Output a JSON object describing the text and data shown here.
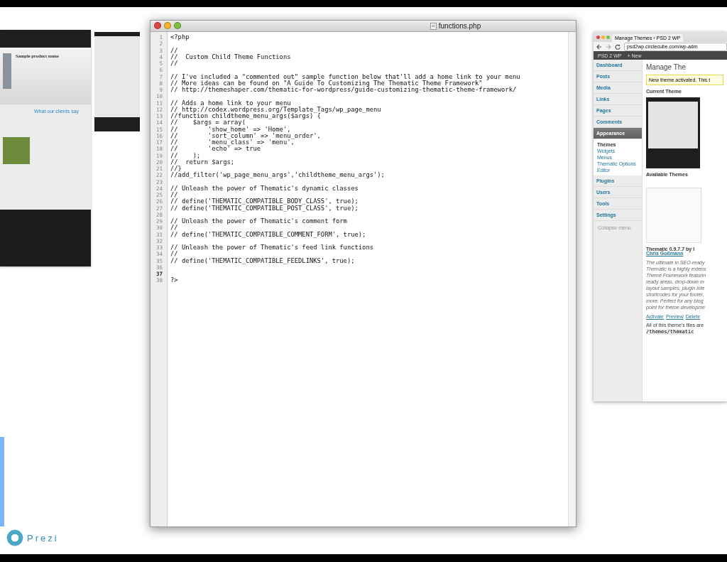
{
  "left_screens": {
    "product_title": "Sample product name",
    "testimonials_heading": "What our clients say"
  },
  "editor": {
    "title": "functions.php",
    "lines": [
      {
        "number": "1",
        "text": "<?php"
      },
      {
        "number": "2"
      },
      {
        "number": "3",
        "text": "//"
      },
      {
        "number": "4",
        "text": "//  Custom Child Theme Functions"
      },
      {
        "number": "5",
        "text": "//"
      },
      {
        "number": "6"
      },
      {
        "number": "7",
        "text": "// I've included a \"commented out\" sample function below that'll add a home link to your menu"
      },
      {
        "number": "8",
        "text": "// More ideas can be found on \"A Guide To Customizing The Thematic Theme Framework\""
      },
      {
        "number": "9",
        "text": "// http://themeshaper.com/thematic-for-wordpress/guide-customizing-thematic-theme-framework/"
      },
      {
        "number": "10"
      },
      {
        "number": "11",
        "text": "// Adds a home link to your menu"
      },
      {
        "number": "12",
        "text": "// http://codex.wordpress.org/Template_Tags/wp_page_menu"
      },
      {
        "number": "13",
        "text": "//function childtheme_menu_args($args) {"
      },
      {
        "number": "14",
        "text": "//    $args = array("
      },
      {
        "number": "15",
        "text": "//        'show_home' => 'Home',"
      },
      {
        "number": "16",
        "text": "//        'sort_column' => 'menu_order',"
      },
      {
        "number": "17",
        "text": "//        'menu_class' => 'menu',"
      },
      {
        "number": "18",
        "text": "//        'echo' => true"
      },
      {
        "number": "19",
        "text": "//    );"
      },
      {
        "number": "20",
        "text": "//  return $args;"
      },
      {
        "number": "21",
        "text": "//}"
      },
      {
        "number": "22",
        "text": "//add_filter('wp_page_menu_args','childtheme_menu_args');"
      },
      {
        "number": "23"
      },
      {
        "number": "24",
        "text": "// Unleash the power of Thematic's dynamic classes"
      },
      {
        "number": "25",
        "text": "//"
      },
      {
        "number": "26",
        "text": "// define('THEMATIC_COMPATIBLE_BODY_CLASS', true);"
      },
      {
        "number": "27",
        "text": "// define('THEMATIC_COMPATIBLE_POST_CLASS', true);"
      },
      {
        "number": "28"
      },
      {
        "number": "29",
        "text": "// Unleash the power of Thematic's comment form"
      },
      {
        "number": "30",
        "text": "//"
      },
      {
        "number": "31",
        "text": "// define('THEMATIC_COMPATIBLE_COMMENT_FORM', true);"
      },
      {
        "number": "32"
      },
      {
        "number": "33",
        "text": "// Unleash the power of Thematic's feed link functions"
      },
      {
        "number": "34",
        "text": "//"
      },
      {
        "number": "35",
        "text": "// define('THEMATIC_COMPATIBLE_FEEDLINKS', true);"
      },
      {
        "number": "36"
      },
      {
        "number": "37"
      },
      {
        "number": "38",
        "text": "?>"
      }
    ]
  },
  "browser": {
    "tab_title": "Manage Themes ‹ PSD 2 WP",
    "url": "psd2wp.circlecube.com/wp-adm",
    "site_name": "PSD 2 WP",
    "new_label": "+ New",
    "menu": [
      {
        "label": "Dashboard",
        "selected": false
      },
      {
        "label": "Posts",
        "selected": false
      },
      {
        "label": "Media",
        "selected": false
      },
      {
        "label": "Links",
        "selected": false
      },
      {
        "label": "Pages",
        "selected": false
      },
      {
        "label": "Comments",
        "selected": false
      },
      {
        "label": "Appearance",
        "selected": true
      },
      {
        "label": "Plugins",
        "selected": false
      },
      {
        "label": "Users",
        "selected": false
      },
      {
        "label": "Tools",
        "selected": false
      },
      {
        "label": "Settings",
        "selected": false
      }
    ],
    "submenu": [
      {
        "label": "Themes",
        "selected": true
      },
      {
        "label": "Widgets",
        "selected": false
      },
      {
        "label": "Menus",
        "selected": false
      },
      {
        "label": "Thematic Options",
        "selected": false
      },
      {
        "label": "Editor",
        "selected": false
      }
    ],
    "collapse_label": "Collapse menu",
    "page_title": "Manage The",
    "notice": "New theme activated. This t",
    "current_theme_heading": "Current Theme",
    "available_heading": "Available Themes",
    "theme_name": "Thematic 0.9.7.7 by I",
    "theme_author": "Chris Goßmann",
    "description": [
      "The ultimate in SEO-ready",
      "Thematic is a highly extens",
      "Theme Framework featurin",
      "ready areas, drop-down m",
      "layout samples, plugin inte",
      "shortcodes for your footer,",
      "more. Perfect for any blog",
      "point for theme developme"
    ],
    "actions": [
      "Activate",
      "Preview",
      "Delete"
    ],
    "files_note": "All of this theme's files are",
    "files_path": "/themes/thematic"
  },
  "logo": {
    "text": "Prezi"
  }
}
